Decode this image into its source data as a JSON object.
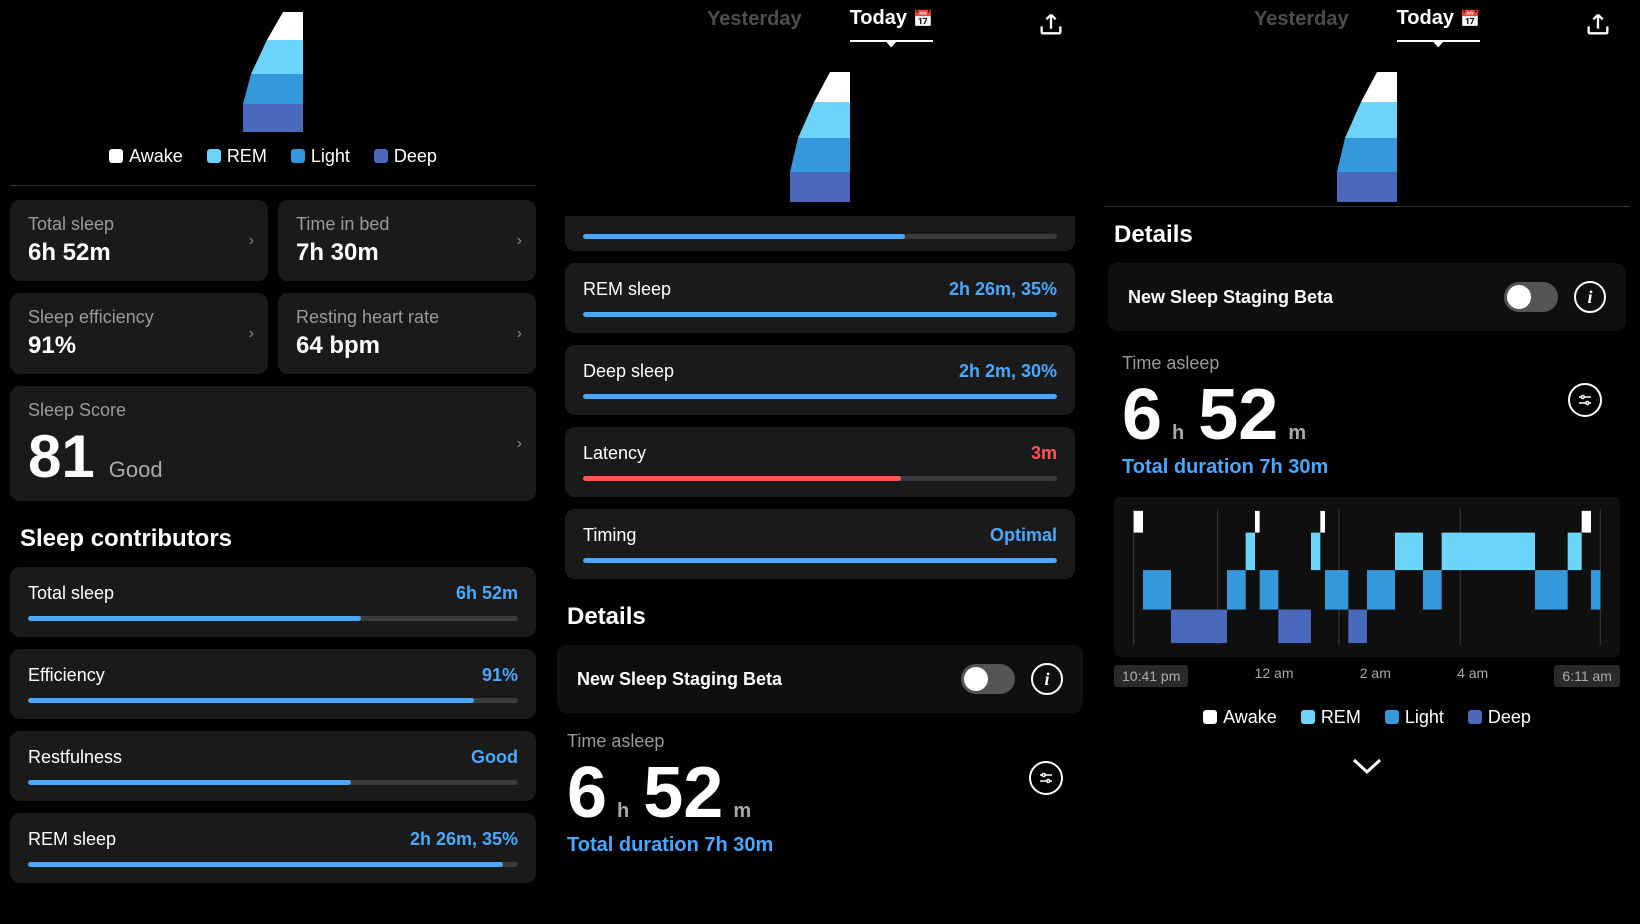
{
  "tabs": {
    "yesterday": "Yesterday",
    "today": "Today"
  },
  "legend": {
    "awake": "Awake",
    "rem": "REM",
    "light": "Light",
    "deep": "Deep"
  },
  "cards": {
    "total_sleep_label": "Total sleep",
    "total_sleep_value": "6h 52m",
    "time_in_bed_label": "Time in bed",
    "time_in_bed_value": "7h 30m",
    "efficiency_label": "Sleep efficiency",
    "efficiency_value": "91%",
    "rhr_label": "Resting heart rate",
    "rhr_value": "64 bpm"
  },
  "score": {
    "title": "Sleep Score",
    "value": "81",
    "word": "Good"
  },
  "contributors_title": "Sleep contributors",
  "details_title": "Details",
  "beta_label": "New Sleep Staging Beta",
  "time_asleep": {
    "label": "Time asleep",
    "h": "6",
    "m": "52",
    "h_unit": "h",
    "m_unit": "m",
    "total": "Total duration 7h 30m"
  },
  "axis": {
    "start": "10:41 pm",
    "t1": "12 am",
    "t2": "2 am",
    "t3": "4 am",
    "end": "6:11 am"
  },
  "contrib": {
    "total_sleep": {
      "label": "Total sleep",
      "value": "6h 52m",
      "pct": 68
    },
    "efficiency": {
      "label": "Efficiency",
      "value": "91%",
      "pct": 91
    },
    "restfulness": {
      "label": "Restfulness",
      "value": "Good",
      "pct": 66
    },
    "rem": {
      "label": "REM sleep",
      "value": "2h 26m, 35%",
      "pct": 97
    },
    "partial_top_pct": 68,
    "deep": {
      "label": "Deep sleep",
      "value": "2h 2m, 30%",
      "pct": 100
    },
    "latency": {
      "label": "Latency",
      "value": "3m",
      "pct": 67
    },
    "timing": {
      "label": "Timing",
      "value": "Optimal",
      "pct": 100
    }
  },
  "chart_data": {
    "type": "area",
    "title": "Sleep stages timeline",
    "x_start": "10:41 pm",
    "x_end": "6:11 am",
    "xticks": [
      "10:41 pm",
      "12 am",
      "2 am",
      "4 am",
      "6:11 am"
    ],
    "stages": [
      "Awake",
      "REM",
      "Light",
      "Deep"
    ],
    "proportions": {
      "Awake": 0.03,
      "REM": 0.35,
      "Light": 0.32,
      "Deep": 0.3
    },
    "segments_estimated": [
      {
        "stage": "Awake",
        "x0": 0.0,
        "x1": 0.02
      },
      {
        "stage": "Light",
        "x0": 0.02,
        "x1": 0.08
      },
      {
        "stage": "Deep",
        "x0": 0.08,
        "x1": 0.2
      },
      {
        "stage": "Light",
        "x0": 0.2,
        "x1": 0.24
      },
      {
        "stage": "REM",
        "x0": 0.24,
        "x1": 0.26
      },
      {
        "stage": "Awake",
        "x0": 0.26,
        "x1": 0.27
      },
      {
        "stage": "Light",
        "x0": 0.27,
        "x1": 0.31
      },
      {
        "stage": "Deep",
        "x0": 0.31,
        "x1": 0.38
      },
      {
        "stage": "REM",
        "x0": 0.38,
        "x1": 0.4
      },
      {
        "stage": "Awake",
        "x0": 0.4,
        "x1": 0.41
      },
      {
        "stage": "Light",
        "x0": 0.41,
        "x1": 0.46
      },
      {
        "stage": "Deep",
        "x0": 0.46,
        "x1": 0.5
      },
      {
        "stage": "Light",
        "x0": 0.5,
        "x1": 0.56
      },
      {
        "stage": "REM",
        "x0": 0.56,
        "x1": 0.62
      },
      {
        "stage": "Light",
        "x0": 0.62,
        "x1": 0.66
      },
      {
        "stage": "REM",
        "x0": 0.66,
        "x1": 0.86
      },
      {
        "stage": "Light",
        "x0": 0.86,
        "x1": 0.93
      },
      {
        "stage": "REM",
        "x0": 0.93,
        "x1": 0.96
      },
      {
        "stage": "Awake",
        "x0": 0.96,
        "x1": 0.98
      },
      {
        "stage": "Light",
        "x0": 0.98,
        "x1": 1.0
      }
    ]
  }
}
